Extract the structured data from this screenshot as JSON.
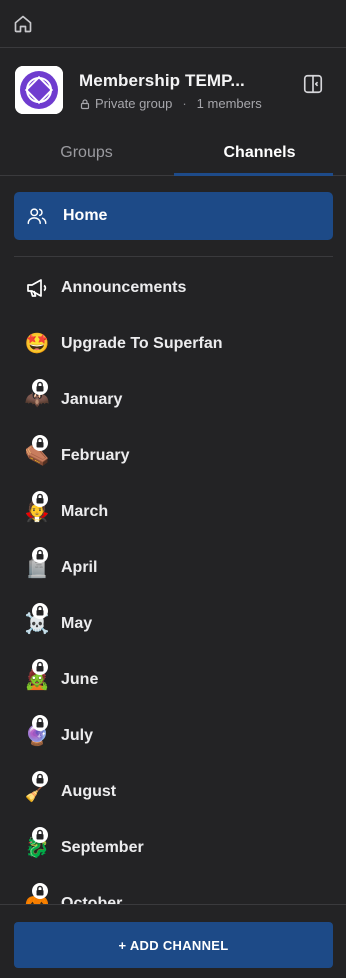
{
  "group": {
    "name": "Membership TEMP...",
    "privacy": "Private group",
    "members": "1 members"
  },
  "tabs": [
    {
      "label": "Groups",
      "active": false
    },
    {
      "label": "Channels",
      "active": true
    }
  ],
  "home_item": {
    "label": "Home"
  },
  "channels": [
    {
      "label": "Announcements",
      "icon": "megaphone-icon",
      "glyph": "",
      "locked": false
    },
    {
      "label": "Upgrade To Superfan",
      "icon": "star-struck-emoji-icon",
      "glyph": "🤩",
      "locked": false
    },
    {
      "label": "January",
      "icon": "bat-emoji-icon",
      "glyph": "🦇",
      "locked": true
    },
    {
      "label": "February",
      "icon": "coffin-emoji-icon",
      "glyph": "⚰️",
      "locked": true
    },
    {
      "label": "March",
      "icon": "vampire-emoji-icon",
      "glyph": "🧛",
      "locked": true
    },
    {
      "label": "April",
      "icon": "headstone-emoji-icon",
      "glyph": "🪦",
      "locked": true
    },
    {
      "label": "May",
      "icon": "skull-crossbones-emoji-icon",
      "glyph": "☠️",
      "locked": true
    },
    {
      "label": "June",
      "icon": "zombie-emoji-icon",
      "glyph": "🧟",
      "locked": true
    },
    {
      "label": "July",
      "icon": "crystal-ball-emoji-icon",
      "glyph": "🔮",
      "locked": true
    },
    {
      "label": "August",
      "icon": "witch-broom-emoji-icon",
      "glyph": "🧹",
      "locked": true
    },
    {
      "label": "September",
      "icon": "dragon-emoji-icon",
      "glyph": "🐉",
      "locked": true
    },
    {
      "label": "October",
      "icon": "pumpkin-emoji-icon",
      "glyph": "🎃",
      "locked": true
    }
  ],
  "footer": {
    "add_channel_label": "+ ADD CHANNEL"
  },
  "colors": {
    "background": "#232325",
    "accent": "#1d4a87",
    "text": "#ffffff",
    "muted": "#a6a6ab"
  }
}
